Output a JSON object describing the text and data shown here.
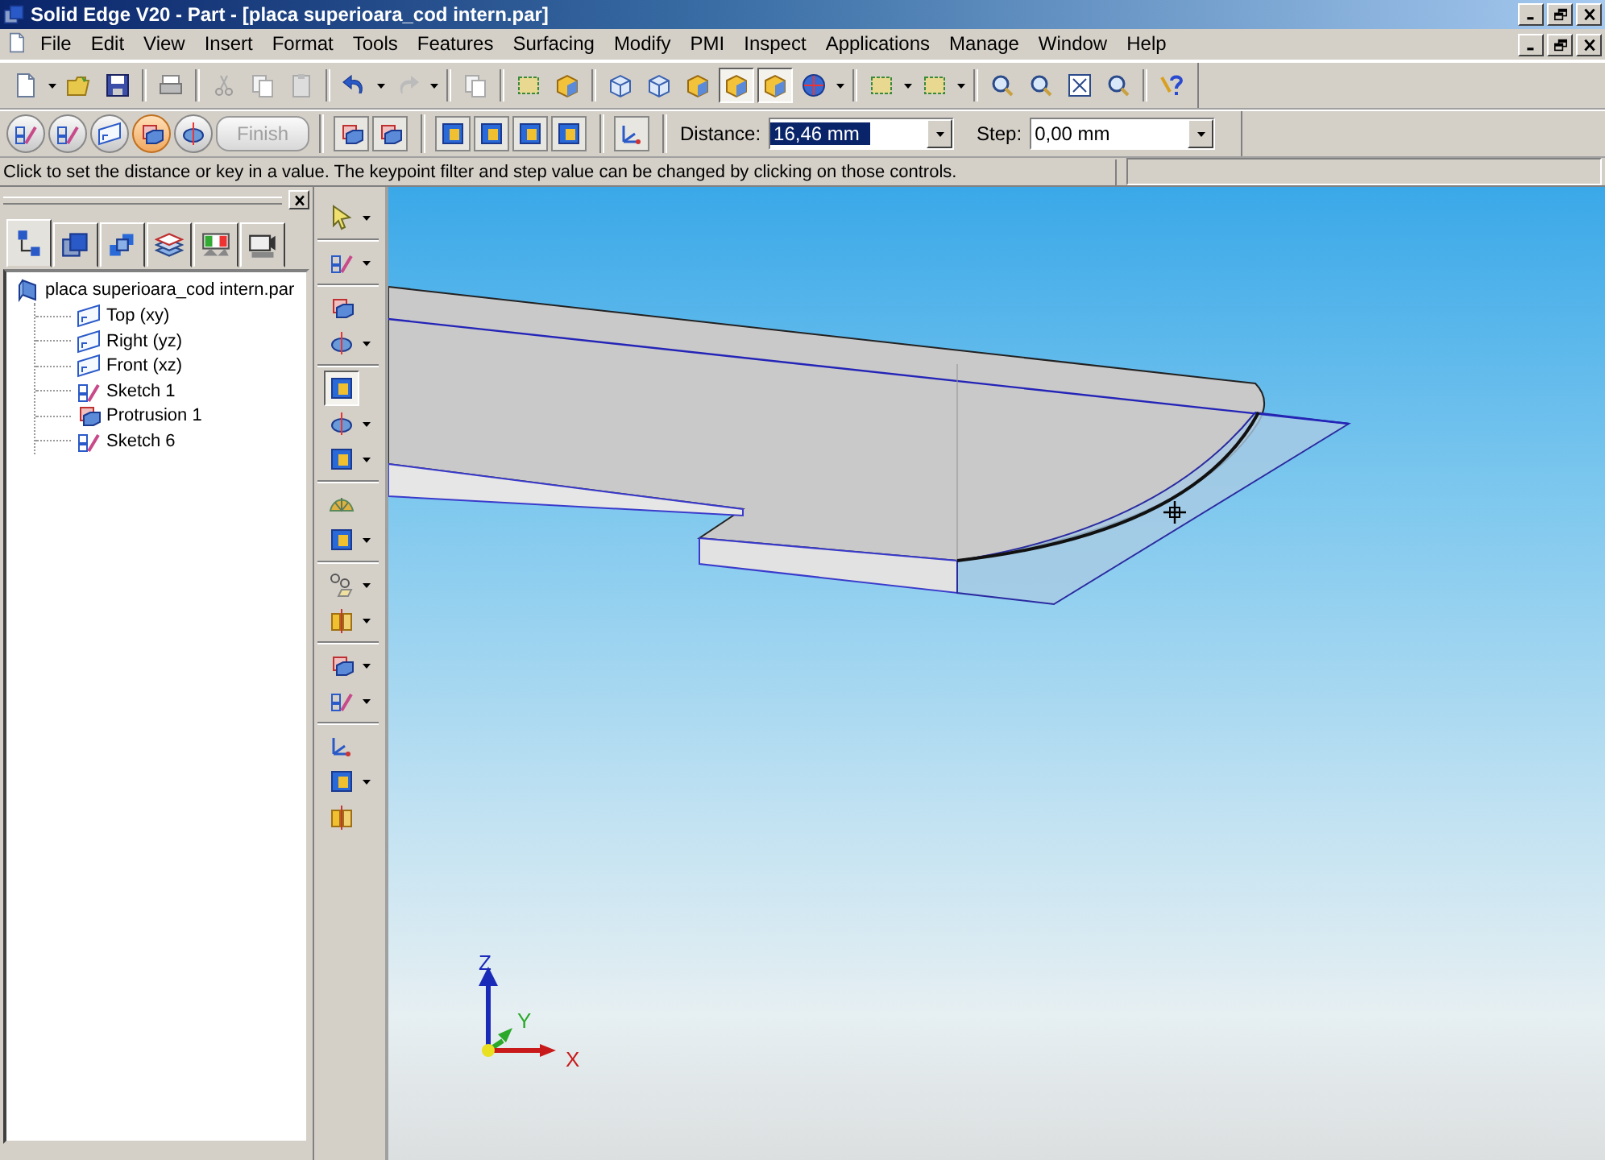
{
  "window": {
    "title": "Solid Edge V20 - Part - [placa superioara_cod intern.par]"
  },
  "menu": [
    "File",
    "Edit",
    "View",
    "Insert",
    "Format",
    "Tools",
    "Features",
    "Surfacing",
    "Modify",
    "PMI",
    "Inspect",
    "Applications",
    "Manage",
    "Window",
    "Help"
  ],
  "toolbar": [
    {
      "kind": "doc",
      "selected": false
    },
    {
      "kind": "caret"
    },
    {
      "kind": "folder",
      "selected": false
    },
    {
      "kind": "disk",
      "selected": false
    },
    {
      "kind": "separator"
    },
    {
      "kind": "printer",
      "selected": false
    },
    {
      "kind": "separator"
    },
    {
      "kind": "scissors",
      "selected": false
    },
    {
      "kind": "copy",
      "selected": false
    },
    {
      "kind": "paste",
      "selected": false
    },
    {
      "kind": "separator"
    },
    {
      "kind": "undo",
      "selected": false
    },
    {
      "kind": "caret"
    },
    {
      "kind": "redo",
      "selected": false
    },
    {
      "kind": "caret"
    },
    {
      "kind": "separator"
    },
    {
      "kind": "copy",
      "selected": false
    },
    {
      "kind": "separator"
    },
    {
      "kind": "frame",
      "selected": false
    },
    {
      "kind": "solid",
      "selected": false
    },
    {
      "kind": "separator"
    },
    {
      "kind": "cube",
      "selected": false
    },
    {
      "kind": "cube",
      "selected": false
    },
    {
      "kind": "solid",
      "selected": false
    },
    {
      "kind": "solid",
      "selected": true
    },
    {
      "kind": "solid",
      "selected": true
    },
    {
      "kind": "sphere",
      "selected": false
    },
    {
      "kind": "caret"
    },
    {
      "kind": "separator"
    },
    {
      "kind": "frame",
      "selected": false
    },
    {
      "kind": "caret"
    },
    {
      "kind": "frame",
      "selected": false
    },
    {
      "kind": "caret"
    },
    {
      "kind": "separator"
    },
    {
      "kind": "zoom",
      "selected": false
    },
    {
      "kind": "zoom",
      "selected": false
    },
    {
      "kind": "fit",
      "selected": false
    },
    {
      "kind": "zoom",
      "selected": false
    },
    {
      "kind": "separator"
    },
    {
      "kind": "help",
      "selected": false
    }
  ],
  "ribbon": {
    "steps": [
      {
        "selected": false
      },
      {
        "selected": false
      },
      {
        "selected": false
      },
      {
        "selected": true
      },
      {
        "selected": false
      }
    ],
    "finish": {
      "label": "Finish",
      "disabled": true
    },
    "sides": [
      {
        "selected": false
      },
      {
        "selected": false
      }
    ],
    "extents": [
      {
        "selected": false
      },
      {
        "selected": false
      },
      {
        "selected": false
      },
      {
        "selected": false
      }
    ],
    "distance": {
      "label": "Distance:",
      "value": "16,46 mm"
    },
    "step": {
      "label": "Step:",
      "value": "0,00 mm"
    }
  },
  "prompt": "Click to set the distance or key in a value. The keypoint filter and step value can be changed by clicking on those controls.",
  "pathfinder": {
    "tabs": [
      {
        "selected": true
      },
      {
        "selected": false
      },
      {
        "selected": false
      },
      {
        "selected": false
      },
      {
        "selected": false
      },
      {
        "selected": false
      }
    ],
    "tree": {
      "label": "placa superioara_cod intern.par",
      "children": [
        {
          "label": "Top (xy)",
          "kind": "plane"
        },
        {
          "label": "Right (yz)",
          "kind": "plane"
        },
        {
          "label": "Front (xz)",
          "kind": "plane"
        },
        {
          "label": "Sketch 1",
          "kind": "sketch"
        },
        {
          "label": "Protrusion 1",
          "kind": "protrusion"
        },
        {
          "label": "Sketch 6",
          "kind": "sketch"
        }
      ]
    }
  },
  "features": [
    {
      "kind": "arrow",
      "selected": false
    },
    {
      "kind": "caret"
    },
    {
      "kind": "separator"
    },
    {
      "kind": "sketch",
      "selected": false
    },
    {
      "kind": "caret"
    },
    {
      "kind": "separator"
    },
    {
      "kind": "protrusion",
      "selected": false
    },
    {
      "kind": "revolve",
      "selected": false
    },
    {
      "kind": "caret"
    },
    {
      "kind": "separator"
    },
    {
      "kind": "face",
      "selected": true
    },
    {
      "kind": "revolve",
      "selected": false
    },
    {
      "kind": "caret"
    },
    {
      "kind": "face",
      "selected": false
    },
    {
      "kind": "caret"
    },
    {
      "kind": "separator"
    },
    {
      "kind": "shell",
      "selected": false
    },
    {
      "kind": "face",
      "selected": false
    },
    {
      "kind": "caret"
    },
    {
      "kind": "separator"
    },
    {
      "kind": "pattern",
      "selected": false
    },
    {
      "kind": "caret"
    },
    {
      "kind": "mirror",
      "selected": false
    },
    {
      "kind": "caret"
    },
    {
      "kind": "separator"
    },
    {
      "kind": "protrusion",
      "selected": false
    },
    {
      "kind": "caret"
    },
    {
      "kind": "sketch",
      "selected": false
    },
    {
      "kind": "caret"
    },
    {
      "kind": "separator"
    },
    {
      "kind": "axes",
      "selected": false
    },
    {
      "kind": "face",
      "selected": false
    },
    {
      "kind": "caret"
    },
    {
      "kind": "mirror",
      "selected": false
    }
  ],
  "triad": {
    "axes": [
      {
        "label": "Z"
      },
      {
        "label": "Y"
      },
      {
        "label": "X"
      }
    ]
  }
}
